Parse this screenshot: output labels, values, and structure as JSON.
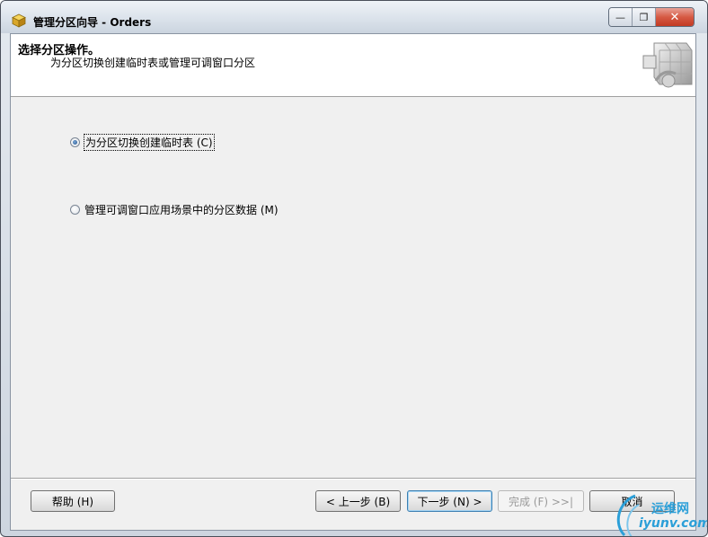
{
  "window": {
    "title": "管理分区向导 - Orders",
    "minimize_glyph": "—",
    "restore_glyph": "❐",
    "close_glyph": "✕"
  },
  "header": {
    "title": "选择分区操作。",
    "subtitle": "为分区切换创建临时表或管理可调窗口分区",
    "graphic_icon": "cube-matrix-icon"
  },
  "options": [
    {
      "label": "为分区切换创建临时表 (C)",
      "checked": true
    },
    {
      "label": "管理可调窗口应用场景中的分区数据 (M)",
      "checked": false
    }
  ],
  "buttons": {
    "help": "帮助 (H)",
    "back": "< 上一步 (B)",
    "next": "下一步 (N) >",
    "finish": "完成 (F) >>|",
    "cancel": "取消"
  },
  "watermark": {
    "line1": "运维网",
    "line2": "iyunv.com"
  },
  "colors": {
    "accent": "#3c7fb1",
    "close_button": "#c23a22",
    "watermark": "#2b9fd8"
  }
}
